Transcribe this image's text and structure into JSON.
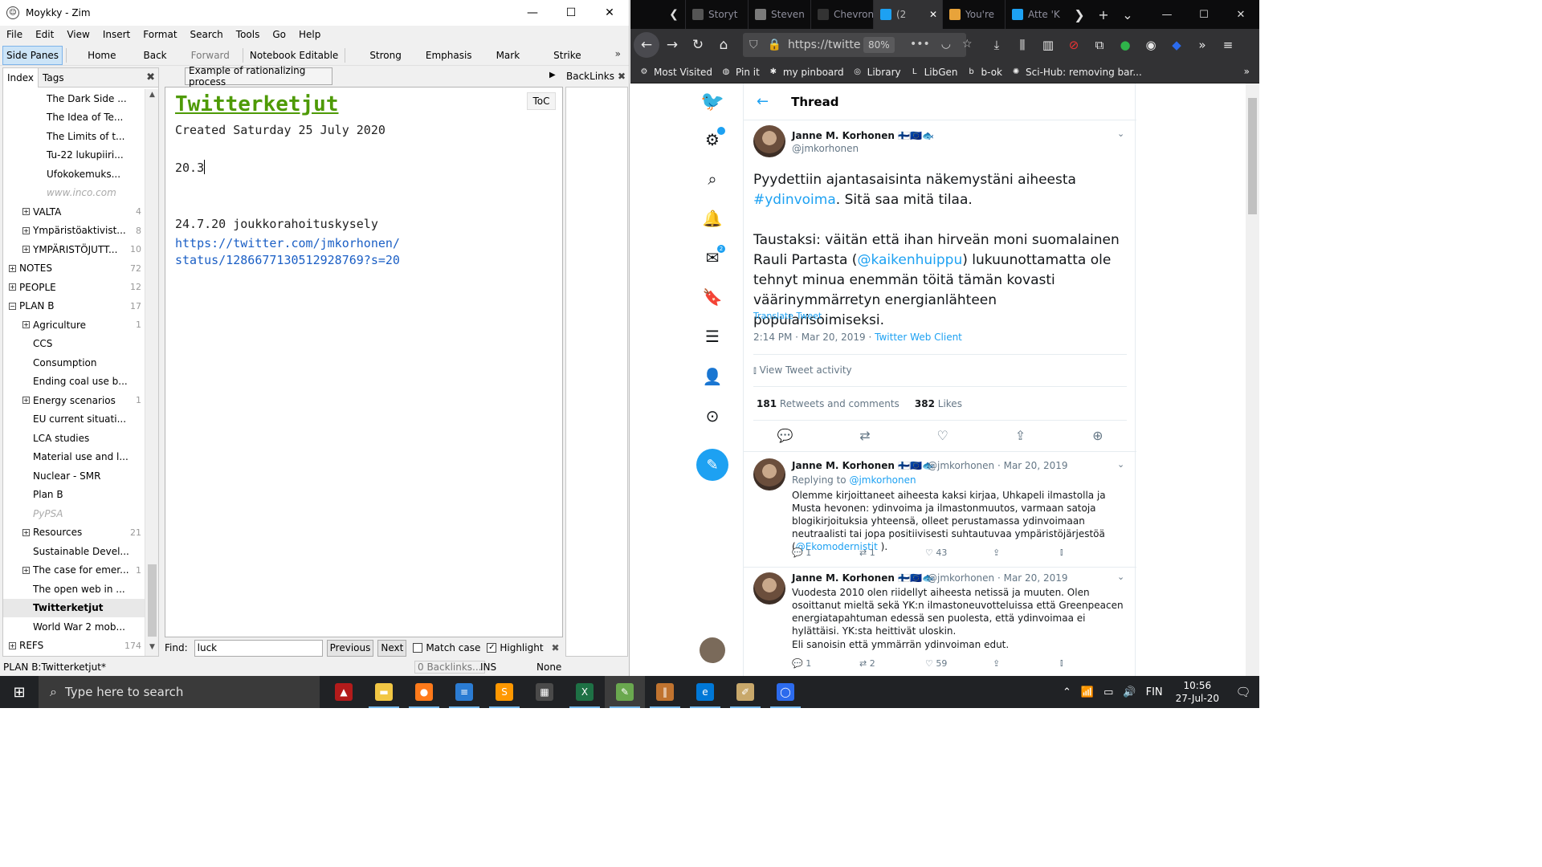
{
  "zim": {
    "window_title": "Moykky - Zim",
    "menu": [
      "File",
      "Edit",
      "View",
      "Insert",
      "Format",
      "Search",
      "Tools",
      "Go",
      "Help"
    ],
    "toolbar": {
      "side_panes": "Side Panes",
      "home": "Home",
      "back": "Back",
      "forward": "Forward",
      "notebook_editable": "Notebook Editable",
      "strong": "Strong",
      "emphasis": "Emphasis",
      "mark": "Mark",
      "strike": "Strike",
      "more": "»"
    },
    "side_tabs": [
      "Index",
      "Tags"
    ],
    "tree": [
      {
        "label": "The Dark Side ...",
        "indent": 2,
        "count": "",
        "exp": false
      },
      {
        "label": "The Idea of Te...",
        "indent": 2,
        "count": "",
        "exp": false
      },
      {
        "label": "The Limits of t...",
        "indent": 2,
        "count": "",
        "exp": false
      },
      {
        "label": "Tu-22 lukupiiri...",
        "indent": 2,
        "count": "",
        "exp": false
      },
      {
        "label": "Ufokokemuks...",
        "indent": 2,
        "count": "",
        "exp": false
      },
      {
        "label": "www.inco.com",
        "indent": 2,
        "count": "",
        "exp": false,
        "grey": true
      },
      {
        "label": "VALTA",
        "indent": 1,
        "count": "4",
        "exp": true
      },
      {
        "label": "Ympäristöaktivist...",
        "indent": 1,
        "count": "8",
        "exp": true
      },
      {
        "label": "YMPÄRISTÖJUTT...",
        "indent": 1,
        "count": "10",
        "exp": true
      },
      {
        "label": "NOTES",
        "indent": 0,
        "count": "72",
        "exp": true
      },
      {
        "label": "PEOPLE",
        "indent": 0,
        "count": "12",
        "exp": true
      },
      {
        "label": "PLAN B",
        "indent": 0,
        "count": "17",
        "exp": true,
        "open": true
      },
      {
        "label": "Agriculture",
        "indent": 1,
        "count": "1",
        "exp": true
      },
      {
        "label": "CCS",
        "indent": 1,
        "count": "",
        "exp": false
      },
      {
        "label": "Consumption",
        "indent": 1,
        "count": "",
        "exp": false
      },
      {
        "label": "Ending coal use b...",
        "indent": 1,
        "count": "",
        "exp": false
      },
      {
        "label": "Energy scenarios",
        "indent": 1,
        "count": "1",
        "exp": true
      },
      {
        "label": "EU current situati...",
        "indent": 1,
        "count": "",
        "exp": false
      },
      {
        "label": "LCA studies",
        "indent": 1,
        "count": "",
        "exp": false
      },
      {
        "label": "Material use and l...",
        "indent": 1,
        "count": "",
        "exp": false
      },
      {
        "label": "Nuclear - SMR",
        "indent": 1,
        "count": "",
        "exp": false
      },
      {
        "label": "Plan B",
        "indent": 1,
        "count": "",
        "exp": false
      },
      {
        "label": "PyPSA",
        "indent": 1,
        "count": "",
        "exp": false,
        "grey": true
      },
      {
        "label": "Resources",
        "indent": 1,
        "count": "21",
        "exp": true
      },
      {
        "label": "Sustainable Devel...",
        "indent": 1,
        "count": "",
        "exp": false
      },
      {
        "label": "The case for emer...",
        "indent": 1,
        "count": "1",
        "exp": true
      },
      {
        "label": "The open web in ...",
        "indent": 1,
        "count": "",
        "exp": false
      },
      {
        "label": "Twitterketjut",
        "indent": 1,
        "count": "",
        "exp": false,
        "selected": true
      },
      {
        "label": "World War 2 mob...",
        "indent": 1,
        "count": "",
        "exp": false
      },
      {
        "label": "REFS",
        "indent": 0,
        "count": "174",
        "exp": true
      }
    ],
    "page_header": "Example of rationalizing process",
    "backlinks_label": "BackLinks",
    "editor": {
      "toc": "ToC",
      "heading": "Twitterketjut",
      "created": "Created Saturday 25 July 2020",
      "line1": "20.3",
      "line2": "24.7.20 joukkorahoituskysely",
      "link1": "https://twitter.com/jmkorhonen/",
      "link2": "status/1286677130512928769?s=20"
    },
    "find": {
      "label": "Find:",
      "value": "luck",
      "previous": "Previous",
      "next": "Next",
      "match_case": "Match case",
      "highlight": "Highlight"
    },
    "status": {
      "path": "PLAN B:Twitterketjut*",
      "backlinks": "0 Backlinks...",
      "mode": "INS",
      "style": "None"
    }
  },
  "firefox": {
    "tabs": [
      {
        "title": "Storyt",
        "color": "#555555"
      },
      {
        "title": "Steven",
        "color": "#7a7a7a"
      },
      {
        "title": "Chevron Is",
        "color": "#333333"
      },
      {
        "title": "(2",
        "color": "#1da1f2",
        "active": true
      },
      {
        "title": "You're",
        "color": "#e8a33a"
      },
      {
        "title": "Atte 'K",
        "color": "#1da1f2"
      }
    ],
    "url": "https://twitte",
    "zoom": "80%",
    "bookmarks": [
      {
        "label": "Most Visited",
        "icon": "⚙"
      },
      {
        "label": "Pin it",
        "icon": "◍"
      },
      {
        "label": "my pinboard",
        "icon": "✱"
      },
      {
        "label": "Library",
        "icon": "◎"
      },
      {
        "label": "LibGen",
        "icon": "L"
      },
      {
        "label": "b-ok",
        "icon": "b"
      },
      {
        "label": "Sci-Hub: removing bar...",
        "icon": "✺"
      }
    ]
  },
  "twitter": {
    "thread_title": "Thread",
    "author_name": "Janne M. Korhonen 🇫🇮🇪🇺🐟",
    "author_handle": "@jmkorhonen",
    "main_text_1": "Pyydettiin ajantasaisinta näkemystäni aiheesta ",
    "hashtag": "#ydinvoima",
    "main_text_2": ". Sitä saa mitä tilaa.",
    "main_text_3": "Taustaksi: väitän että ihan hirveän moni suomalainen Rauli Partasta (",
    "mention": "@kaikenhuippu",
    "main_text_4": ") lukuunottamatta ole tehnyt minua enemmän töitä tämän kovasti väärinymmärretyn energianlähteen popularisoimiseksi.",
    "translate": "Translate Tweet",
    "timestamp": "2:14 PM · Mar 20, 2019 · ",
    "client": "Twitter Web Client",
    "activity": "View Tweet activity",
    "retweets_count": "181",
    "retweets_label": "Retweets and comments",
    "likes_count": "382",
    "likes_label": "Likes",
    "replies": [
      {
        "name": "Janne M. Korhonen 🇫🇮🇪🇺🐟",
        "meta": "@jmkorhonen · Mar 20, 2019",
        "replying_label": "Replying to ",
        "replying_handle": "@jmkorhonen",
        "text": "Olemme kirjoittaneet aiheesta kaksi kirjaa, Uhkapeli ilmastolla ja Musta hevonen: ydinvoima ja ilmastonmuutos, varmaan satoja blogikirjoituksia yhteensä, olleet perustamassa ydinvoimaan neutraalisti tai jopa positiivisesti suhtautuvaa ympäristöjärjestöä (",
        "text_mention": "@Ekomodernistit",
        "text_end": " ).",
        "replies": "1",
        "retweets": "1",
        "likes": "43"
      },
      {
        "name": "Janne M. Korhonen 🇫🇮🇪🇺🐟",
        "meta": "@jmkorhonen · Mar 20, 2019",
        "text": "Vuodesta 2010 olen riidellyt aiheesta netissä ja muuten. Olen osoittanut mieltä sekä YK:n ilmastoneuvotteluissa että Greenpeacen energiatapahtuman edessä sen puolesta, että ydinvoimaa ei hylättäisi. YK:sta heittivät uloskin.",
        "text2": "Eli sanoisin että ymmärrän ydinvoiman edut.",
        "replies": "1",
        "retweets": "2",
        "likes": "59"
      }
    ]
  },
  "taskbar": {
    "search_placeholder": "Type here to search",
    "language": "FIN",
    "time": "10:56",
    "date": "27-Jul-20",
    "apps": [
      {
        "name": "mendeley",
        "color": "#b31b1b",
        "glyph": "▲"
      },
      {
        "name": "file-explorer",
        "color": "#f2c744",
        "glyph": "▬"
      },
      {
        "name": "firefox",
        "color": "#ff7a1a",
        "glyph": "●"
      },
      {
        "name": "document-app",
        "color": "#2b7cd3",
        "glyph": "≡"
      },
      {
        "name": "sublime-text",
        "color": "#ff9800",
        "glyph": "S"
      },
      {
        "name": "calculator",
        "color": "#4a4a4a",
        "glyph": "▦"
      },
      {
        "name": "excel",
        "color": "#1e7145",
        "glyph": "X"
      },
      {
        "name": "zim",
        "color": "#6aa84f",
        "glyph": "✎"
      },
      {
        "name": "library-app",
        "color": "#c0732f",
        "glyph": "‖"
      },
      {
        "name": "edge",
        "color": "#0078d7",
        "glyph": "e"
      },
      {
        "name": "notepad-app",
        "color": "#c8a86b",
        "glyph": "✐"
      },
      {
        "name": "signal",
        "color": "#2c6bed",
        "glyph": "◯"
      }
    ]
  }
}
